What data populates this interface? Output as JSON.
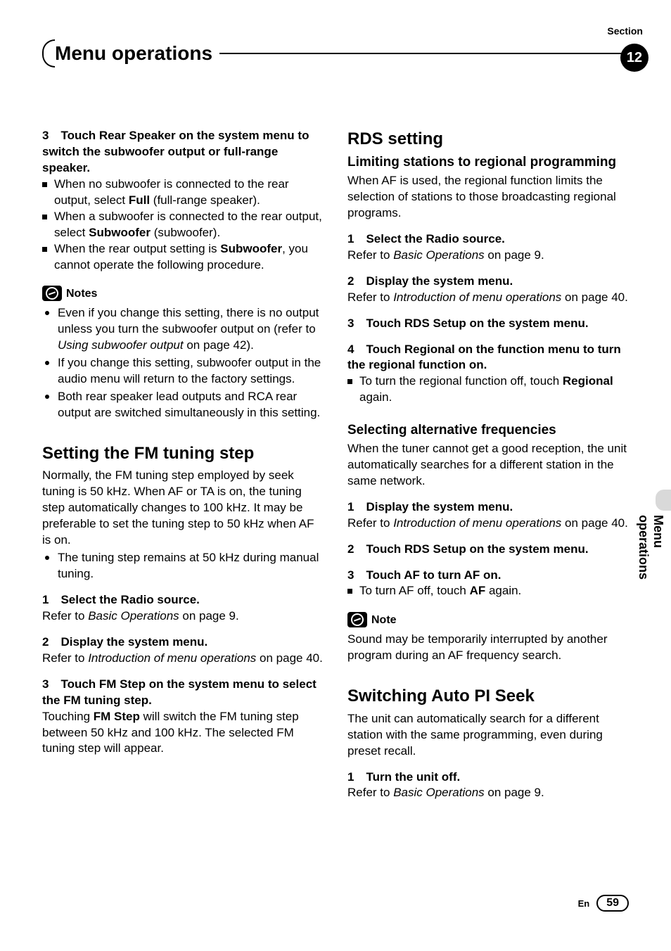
{
  "header": {
    "section_label": "Section",
    "title": "Menu operations",
    "section_number": "12",
    "side_tab": "Menu operations"
  },
  "left": {
    "s3": {
      "head": "3 Touch Rear Speaker on the system menu to switch the subwoofer output or full-range speaker.",
      "b1_pre": "When no subwoofer is connected to the rear output, select ",
      "b1_bold": "Full",
      "b1_post": " (full-range speaker).",
      "b2_pre": "When a subwoofer is connected to the rear output, select ",
      "b2_bold": "Subwoofer",
      "b2_post": " (subwoofer).",
      "b3_pre": "When the rear output setting is ",
      "b3_bold": "Subwoofer",
      "b3_post": ", you cannot operate the following procedure."
    },
    "notes": {
      "title": "Notes",
      "n1a": "Even if you change this setting, there is no output unless you turn the subwoofer output on (refer to ",
      "n1i": "Using subwoofer output",
      "n1b": " on page 42).",
      "n2": "If you change this setting, subwoofer output in the audio menu will return to the factory settings.",
      "n3": "Both rear speaker lead outputs and RCA rear output are switched simultaneously in this setting."
    },
    "fm": {
      "h2": "Setting the FM tuning step",
      "intro": "Normally, the FM tuning step employed by seek tuning is 50 kHz. When AF or TA is on, the tuning step automatically changes to 100 kHz. It may be preferable to set the tuning step to 50 kHz when AF is on.",
      "bullet": "The tuning step remains at 50 kHz during manual tuning.",
      "s1": "1 Select the Radio source.",
      "s1ref_a": "Refer to ",
      "s1ref_i": "Basic Operations",
      "s1ref_b": " on page 9.",
      "s2": "2 Display the system menu.",
      "s2ref_a": "Refer to ",
      "s2ref_i": "Introduction of menu operations",
      "s2ref_b": " on page 40.",
      "s3": "3 Touch FM Step on the system menu to select the FM tuning step.",
      "s3body_a": "Touching ",
      "s3body_bold": "FM Step",
      "s3body_b": " will switch the FM tuning step between 50 kHz and 100 kHz. The selected FM tuning step will appear."
    }
  },
  "right": {
    "rds": {
      "h2": "RDS setting",
      "h3a": "Limiting stations to regional programming",
      "intro": "When AF is used, the regional function limits the selection of stations to those broadcasting regional programs.",
      "s1": "1 Select the Radio source.",
      "s1ref_a": "Refer to ",
      "s1ref_i": "Basic Operations",
      "s1ref_b": " on page 9.",
      "s2": "2 Display the system menu.",
      "s2ref_a": "Refer to ",
      "s2ref_i": "Introduction of menu operations",
      "s2ref_b": " on page 40.",
      "s3": "3 Touch RDS Setup on the system menu.",
      "s4": "4 Touch Regional on the function menu to turn the regional function on.",
      "s4b_pre": "To turn the regional function off, touch ",
      "s4b_bold": "Regional",
      "s4b_post": " again.",
      "h3b": "Selecting alternative frequencies",
      "alt_intro": "When the tuner cannot get a good reception, the unit automatically searches for a different station in the same network.",
      "a1": "1 Display the system menu.",
      "a1ref_a": "Refer to ",
      "a1ref_i": "Introduction of menu operations",
      "a1ref_b": " on page 40.",
      "a2": "2 Touch RDS Setup on the system menu.",
      "a3": "3 Touch AF to turn AF on.",
      "a3b_pre": "To turn AF off, touch ",
      "a3b_bold": "AF",
      "a3b_post": " again."
    },
    "note": {
      "title": "Note",
      "body": "Sound may be temporarily interrupted by another program during an AF frequency search."
    },
    "pi": {
      "h2": "Switching Auto PI Seek",
      "intro": "The unit can automatically search for a different station with the same programming, even during preset recall.",
      "s1": "1 Turn the unit off.",
      "s1ref_a": "Refer to ",
      "s1ref_i": "Basic Operations",
      "s1ref_b": " on page 9."
    }
  },
  "footer": {
    "lang": "En",
    "page": "59"
  }
}
